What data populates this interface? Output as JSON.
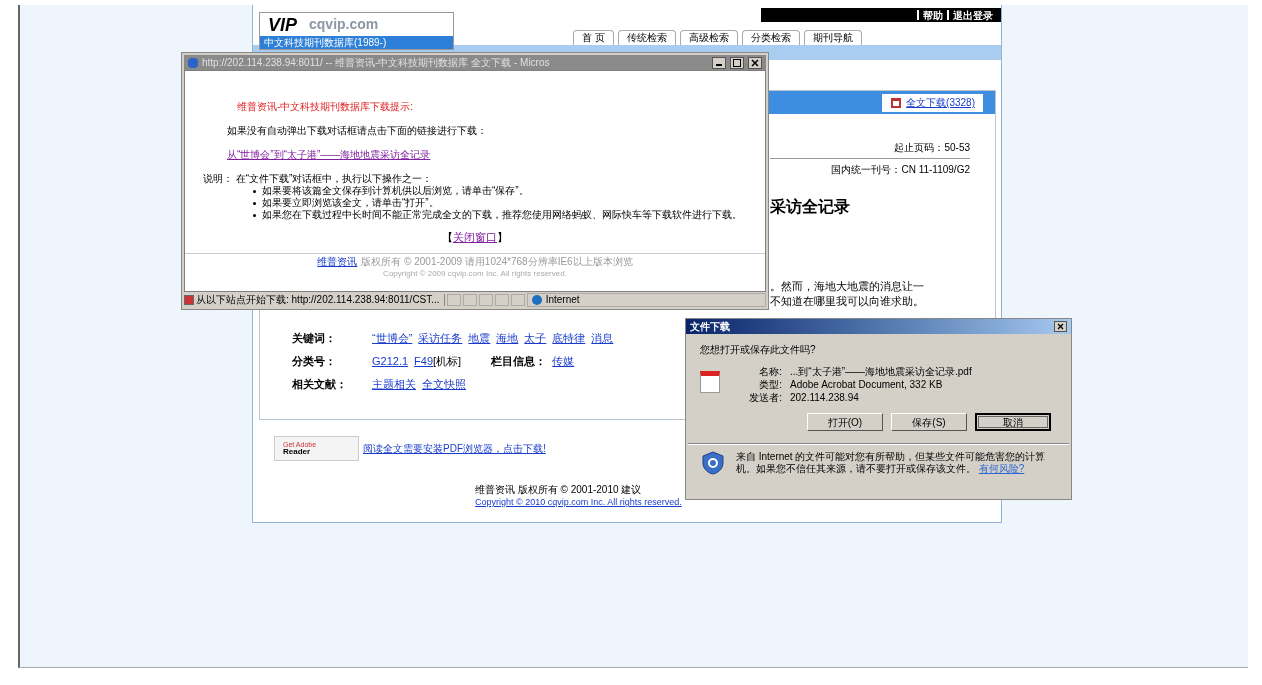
{
  "site": {
    "logo": {
      "mark": "VIP",
      "domain": "cqvip.com",
      "subtitle": "中文科技期刊数据库(1989-)"
    },
    "top_links": [
      "帮助",
      "退出登录"
    ],
    "nav": [
      {
        "label": "首 页",
        "selected": false
      },
      {
        "label": "传统检索",
        "selected": false
      },
      {
        "label": "高级检索",
        "selected": false
      },
      {
        "label": "分类检索",
        "selected": false
      },
      {
        "label": "期刊导航",
        "selected": false
      }
    ],
    "download_link": "全文下载(3328)",
    "pages": "起止页码：50-53",
    "issn": "国内统一刊号：CN 11-1109/G2",
    "title_fragment": "采访全记录",
    "body_fragments": [
      "。然而，海地大地震的消息让一",
      "不知道在哪里我可以向谁求助。"
    ],
    "meta_rows": [
      {
        "label": "关键词：",
        "items": [
          {
            "kind": "link",
            "text": "“世博会”"
          },
          {
            "kind": "link",
            "text": "采访任务"
          },
          {
            "kind": "link",
            "text": "地震"
          },
          {
            "kind": "link",
            "text": "海地"
          },
          {
            "kind": "link",
            "text": "太子"
          },
          {
            "kind": "link",
            "text": "底特律"
          },
          {
            "kind": "link",
            "text": "消息"
          }
        ]
      },
      {
        "label": "分类号：",
        "items": [
          {
            "kind": "link",
            "text": "G212.1"
          },
          {
            "kind": "link",
            "text": "F49"
          },
          {
            "kind": "text",
            "text": "[机标]"
          },
          {
            "kind": "label",
            "text": "栏目信息："
          },
          {
            "kind": "link",
            "text": "传媒"
          }
        ]
      },
      {
        "label": "相关文献：",
        "items": [
          {
            "kind": "link",
            "text": "主题相关"
          },
          {
            "kind": "link",
            "text": "全文快照"
          }
        ]
      }
    ],
    "reader_badge": {
      "top": "Get Adobe",
      "bottom": "Reader"
    },
    "reader_link": "阅读全文需要安装PDF浏览器，点击下载!",
    "footer": "维普资讯 版权所有 © 2001-2010 建议",
    "footer_copyright": "Copyright © 2010 cqvip.com Inc. All rights reserved."
  },
  "popup": {
    "title": "http://202.114.238.94:8011/ -- 维普资讯-中文科技期刊数据库 全文下载 - Micros",
    "heading": "维普资讯-中文科技期刊数据库下载提示:",
    "intro": "如果没有自动弹出下载对话框请点击下面的链接进行下载：",
    "article_link": "从“世博会”到“太子港”——海地地震采访全记录",
    "note": "说明： 在“文件下载”对话框中，执行以下操作之一：",
    "bullets": [
      "如果要将该篇全文保存到计算机供以后浏览，请单击“保存”。",
      "如果要立即浏览该全文，请单击“打开”。",
      "如果您在下载过程中长时间不能正常完成全文的下载，推荐您使用网络蚂蚁、网际快车等下载软件进行下载。"
    ],
    "close_link": {
      "open": "【",
      "label": "关闭窗口",
      "close": "】"
    },
    "footer_brand": "维普资讯",
    "footer_text": "版权所有 © 2001-2009 请用1024*768分辨率IE6以上版本浏览",
    "footer_copyright": "Copyright © 2009 cqvip.com Inc. All rights reserved.",
    "status_text": "从以下站点开始下载: http://202.114.238.94:8011/CST...",
    "status_zone": "Internet"
  },
  "dialog": {
    "title": "文件下载",
    "question": "您想打开或保存此文件吗?",
    "fields": [
      {
        "label": "名称:",
        "value": "...到“太子港”——海地地震采访全记录.pdf"
      },
      {
        "label": "类型:",
        "value": "Adobe Acrobat Document, 332 KB"
      },
      {
        "label": "发送者:",
        "value": "202.114.238.94"
      }
    ],
    "buttons": [
      {
        "label": "打开(O)",
        "selected": false
      },
      {
        "label": "保存(S)",
        "selected": false
      },
      {
        "label": "取消",
        "selected": true
      }
    ],
    "warning": "来自 Internet 的文件可能对您有所帮助，但某些文件可能危害您的计算机。如果您不信任其来源，请不要打开或保存该文件。",
    "risk_link": "有何风险?"
  }
}
